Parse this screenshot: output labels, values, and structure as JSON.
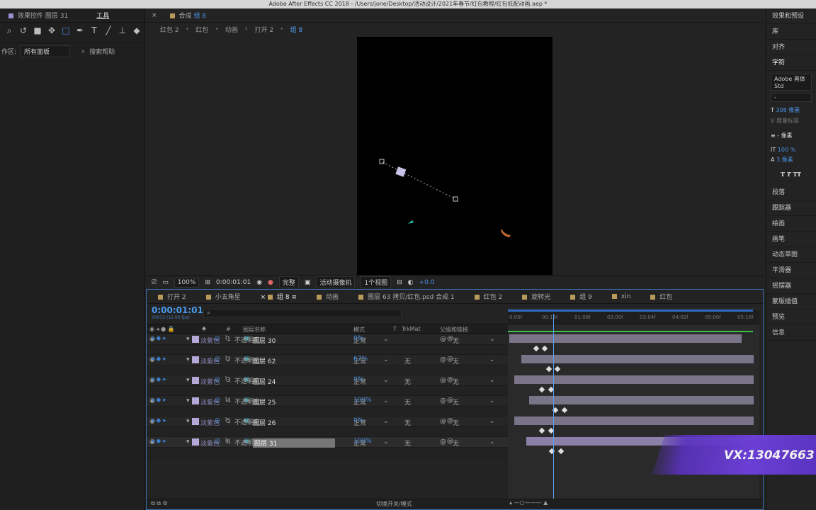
{
  "window": {
    "title": "Adobe After Effects CC 2018 - /Users/jone/Desktop/活动设计/2021年春节/红包教程/红包低配动画.aep *"
  },
  "left_panel": {
    "tab_effects": "效果控件 图层 31",
    "tab_tools": "工具",
    "workspace_label": "作区:",
    "workspace_value": "所有面板",
    "search_help": "搜索帮助"
  },
  "comp_panel": {
    "tab": "合成",
    "tab_comp": "组 8",
    "breadcrumbs": [
      "红包 2",
      "红包",
      "动画",
      "打开 2",
      "组 8"
    ],
    "zoom": "100%",
    "timecode": "0:00:01:01",
    "quality": "完整",
    "camera": "活动摄像机",
    "views": "1个视图",
    "exposure": "+0.0"
  },
  "right_panel": {
    "items": [
      "效果和预设",
      "库",
      "对齐",
      "字符",
      "段落",
      "跟踪器",
      "绘画",
      "画笔",
      "动态草图",
      "平滑器",
      "摇摆器",
      "蒙版插值",
      "预览",
      "信息"
    ],
    "font": "Adobe 黑体 Std",
    "font_style": "-",
    "font_size": "308 像素",
    "leading": "度量标准",
    "tracking": "- 像素",
    "scale": "100 %",
    "baseline": "3 像素"
  },
  "timeline": {
    "tabs": [
      "打开 2",
      "小五角星",
      "组 8",
      "动画",
      "图层 63 拷贝/红包.psd 合成 1",
      "红包 2",
      "旋转光",
      "组 9",
      "xin",
      "红包"
    ],
    "timecode": "0:00:01:01",
    "fps": "00013 (12.00 fps)",
    "columns": {
      "num": "#",
      "name": "图层名称",
      "mode": "模式",
      "t": "T",
      "trkmat": "TrkMat",
      "parent": "父级和链接"
    },
    "ruler": [
      "0:00f",
      "00:16f",
      "01:08f",
      "02:00f",
      "03:04f",
      "04:02f",
      "05:00f",
      "05:16f"
    ],
    "layers": [
      {
        "num": "1",
        "label": "淡紫色",
        "name": "图层 30",
        "mode": "正常",
        "trkmat": "",
        "parent": "无",
        "prop": "不透明度",
        "value": "0%",
        "bar_start": 0.0,
        "bar_end": 0.95
      },
      {
        "num": "2",
        "label": "淡紫色",
        "name": "图层 62",
        "mode": "正常",
        "trkmat": "无",
        "parent": "无",
        "prop": "不透明度",
        "value": "67%",
        "bar_start": 0.05,
        "bar_end": 1.0
      },
      {
        "num": "3",
        "label": "淡紫色",
        "name": "图层 24",
        "mode": "正常",
        "trkmat": "无",
        "parent": "无",
        "prop": "不透明度",
        "value": "0%",
        "bar_start": 0.02,
        "bar_end": 1.0
      },
      {
        "num": "4",
        "label": "淡紫色",
        "name": "图层 25",
        "mode": "正常",
        "trkmat": "无",
        "parent": "无",
        "prop": "不透明度",
        "value": "100%",
        "bar_start": 0.08,
        "bar_end": 1.0
      },
      {
        "num": "5",
        "label": "淡紫色",
        "name": "图层 26",
        "mode": "正常",
        "trkmat": "无",
        "parent": "无",
        "prop": "不透明度",
        "value": "0%",
        "bar_start": 0.02,
        "bar_end": 1.0
      },
      {
        "num": "6",
        "label": "淡紫色",
        "name": "图层 31",
        "mode": "正常",
        "trkmat": "无",
        "parent": "无",
        "prop": "不透明度",
        "value": "100%",
        "bar_start": 0.07,
        "bar_end": 1.0
      }
    ],
    "footer": "切换开关/模式"
  },
  "watermark": "VX:13047663",
  "colors": {
    "accent": "#4a8fe0",
    "label": "#b4a8d8",
    "layer_bar": "#7a7488"
  }
}
